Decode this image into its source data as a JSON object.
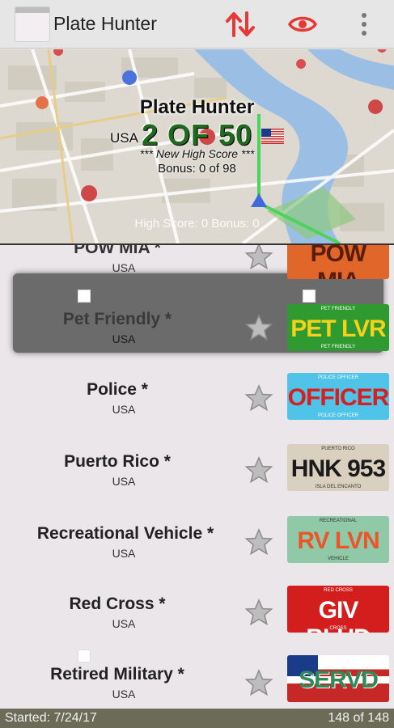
{
  "app_bar": {
    "title": "Plate Hunter",
    "icons": [
      "sort-swap-icon",
      "eye-icon",
      "more-vert-icon"
    ],
    "accent": "#e53935"
  },
  "map_header": {
    "title": "Plate Hunter",
    "country": "USA",
    "count": "2 OF 50",
    "high_score_msg": "*** New High Score ***",
    "bonus": "Bonus: 0 of 98",
    "high_score_line": "High Score: 0 Bonus: 0",
    "count_color": "#1f6a1f"
  },
  "plates": [
    {
      "name": "POW MIA *",
      "country": "USA",
      "plate_text": "POW MIA",
      "top": "",
      "bottom": "",
      "bg": "#e0662a",
      "fg": "#5a1e08",
      "selected": false
    },
    {
      "name": "Pet Friendly *",
      "country": "USA",
      "plate_text": "PET LVR",
      "top": "PET FRIENDLY",
      "bottom": "PET FRIENDLY",
      "bg": "#2f9a2f",
      "fg": "#f5d21a",
      "selected": true
    },
    {
      "name": "Police *",
      "country": "USA",
      "plate_text": "OFFICER",
      "top": "POLICE OFFICER",
      "bottom": "POLICE OFFICER",
      "bg": "#4fc3e8",
      "fg": "#d62020",
      "selected": false
    },
    {
      "name": "Puerto Rico *",
      "country": "USA",
      "plate_text": "HNK 953",
      "top": "PUERTO RICO",
      "bottom": "ISLA DEL ENCANTO",
      "bg": "#d9d0bf",
      "fg": "#1a1a1a",
      "selected": false
    },
    {
      "name": "Recreational Vehicle *",
      "country": "USA",
      "plate_text": "RV LVN",
      "top": "RECREATIONAL",
      "bottom": "VEHICLE",
      "bg": "#8fc9a7",
      "fg": "#e8562a",
      "selected": false
    },
    {
      "name": "Red Cross *",
      "country": "USA",
      "plate_text": "GIV BLUD",
      "top": "RED CROSS",
      "bottom": "CROSS",
      "bg": "#d41e1e",
      "fg": "#ffffff",
      "selected": false
    },
    {
      "name": "Retired Military *",
      "country": "USA",
      "plate_text": "SERVD",
      "top": "",
      "bottom": "",
      "bg": "#b03030",
      "fg": "#2e8b57",
      "selected": false
    }
  ],
  "footer": {
    "started": "Started: 7/24/17",
    "progress": "148 of 148"
  }
}
